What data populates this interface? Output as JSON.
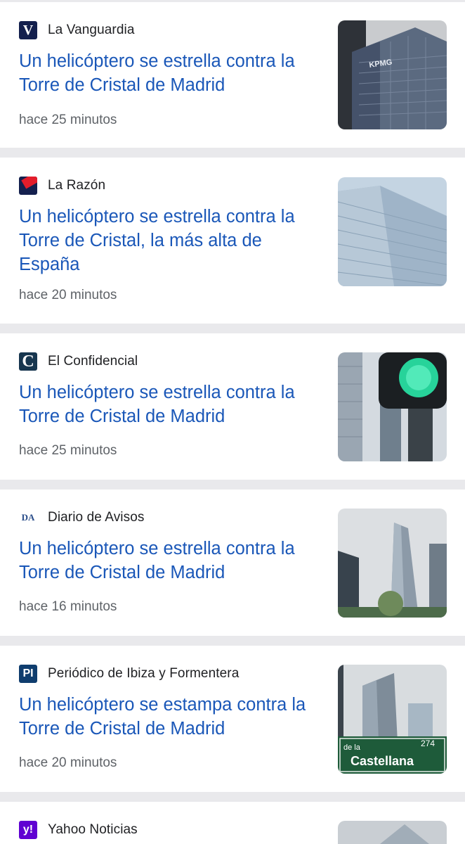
{
  "articles": [
    {
      "source": "La Vanguardia",
      "logo_text": "V",
      "logo_color": "#14204e",
      "headline": "Un helicóptero se estrella contra la Torre de Cristal de Madrid",
      "time": "hace 25 minutos",
      "image_text": "KPMG"
    },
    {
      "source": "La Razón",
      "logo_text": "",
      "logo_color": "#e31d2b",
      "headline": "Un helicóptero se estrella contra la Torre de Cristal, la más alta de España",
      "time": "hace 20 minutos"
    },
    {
      "source": "El Confidencial",
      "logo_text": "C",
      "logo_color": "#17364f",
      "headline": "Un helicóptero se estrella contra la Torre de Cristal de Madrid",
      "time": "hace 25 minutos"
    },
    {
      "source": "Diario de Avisos",
      "logo_text": "DA",
      "logo_color": "#2a4d8a",
      "headline": "Un helicóptero se estrella contra la Torre de Cristal de Madrid",
      "time": "hace 16 minutos"
    },
    {
      "source": "Periódico de Ibiza y Formentera",
      "logo_text": "PI",
      "logo_color": "#0f3d6e",
      "headline": "Un helicóptero se estampa contra la Torre de Cristal de Madrid",
      "time": "hace 20 minutos",
      "image_text_1": "de la",
      "image_text_2": "274",
      "image_text_3": "Castellana"
    },
    {
      "source": "Yahoo Noticias",
      "logo_text": "y!",
      "logo_color": "#6001d2"
    }
  ]
}
